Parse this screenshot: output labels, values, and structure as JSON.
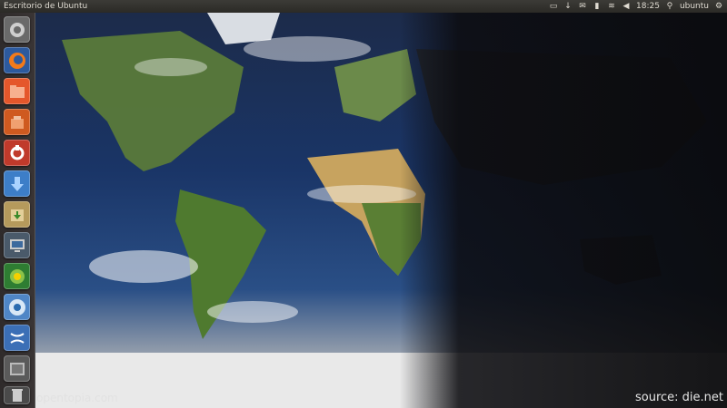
{
  "top_panel": {
    "title": "Escritorio de Ubuntu",
    "tray": {
      "time": "18:25",
      "user": "ubuntu",
      "icons": [
        "display-icon",
        "download-arrow-icon",
        "mail-icon",
        "battery-icon",
        "wifi-icon",
        "volume-icon",
        "user-icon",
        "gear-icon"
      ]
    }
  },
  "launcher": {
    "items": [
      {
        "icon": "dash-home-icon"
      },
      {
        "icon": "firefox-icon"
      },
      {
        "icon": "files-icon"
      },
      {
        "icon": "ubuntu-one-icon"
      },
      {
        "icon": "system-settings-icon"
      },
      {
        "icon": "software-center-icon"
      },
      {
        "icon": "archive-manager-icon"
      },
      {
        "icon": "remote-desktop-icon"
      },
      {
        "icon": "wired-network-icon"
      },
      {
        "icon": "chrome-icon"
      },
      {
        "icon": "dna-app-icon"
      },
      {
        "icon": "workspace-switcher-icon"
      },
      {
        "icon": "trash-icon"
      }
    ]
  },
  "wallpaper": {
    "left_watermark": "opentopia.com",
    "right_watermark": "source: die.net"
  },
  "colors": {
    "panel": "#3c3b37",
    "launcher": "#2f2b2b",
    "firefox": "#f27a1a",
    "files": "#e5572b"
  }
}
